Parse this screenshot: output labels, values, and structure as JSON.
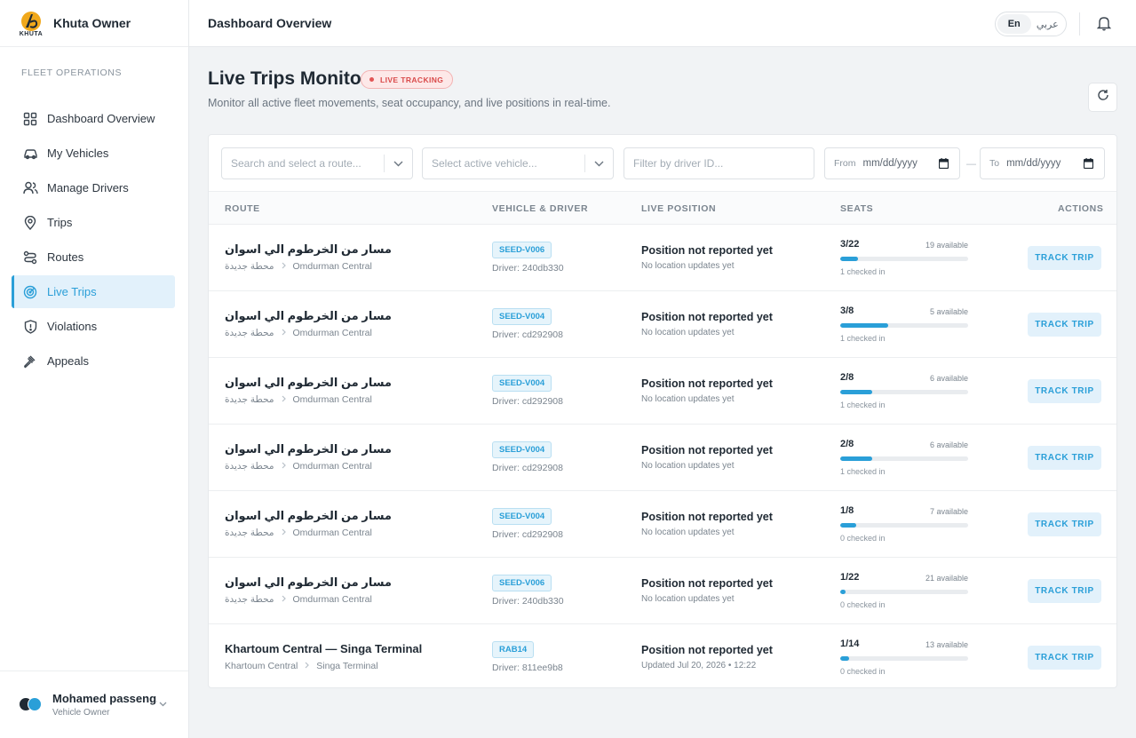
{
  "brand": {
    "name": "Khuta Owner",
    "logo_text": "KHUTA"
  },
  "sidebar": {
    "section_label": "FLEET OPERATIONS",
    "items": [
      {
        "label": "Dashboard Overview",
        "icon": "grid-icon"
      },
      {
        "label": "My Vehicles",
        "icon": "car-icon"
      },
      {
        "label": "Manage Drivers",
        "icon": "users-icon"
      },
      {
        "label": "Trips",
        "icon": "map-pin-icon"
      },
      {
        "label": "Routes",
        "icon": "route-icon"
      },
      {
        "label": "Live Trips",
        "icon": "radar-icon",
        "active": true
      },
      {
        "label": "Violations",
        "icon": "shield-alert-icon"
      },
      {
        "label": "Appeals",
        "icon": "gavel-icon"
      }
    ],
    "user": {
      "name": "Mohamed passeng...",
      "role": "Vehicle Owner"
    }
  },
  "header": {
    "title": "Dashboard Overview",
    "lang_en": "En",
    "lang_ar": "عربي"
  },
  "page": {
    "title": "Live Trips Monitor",
    "badge": "LIVE TRACKING",
    "subtitle": "Monitor all active fleet movements, seat occupancy, and live positions in real-time."
  },
  "filters": {
    "route_placeholder": "Search and select a route...",
    "vehicle_placeholder": "Select active vehicle...",
    "driver_placeholder": "Filter by driver ID...",
    "from_label": "From",
    "to_label": "To",
    "date_placeholder": "mm/dd/yyyy",
    "separator": "—"
  },
  "table": {
    "headers": {
      "route": "ROUTE",
      "vehicle": "VEHICLE & DRIVER",
      "position": "LIVE POSITION",
      "seats": "SEATS",
      "actions": "ACTIONS"
    },
    "action_label": "TRACK TRIP",
    "rows": [
      {
        "route": "مسار من الخرطوم الي اسوان",
        "from": "محطة جديدة",
        "to": "Omdurman Central",
        "vehicle": "SEED-V006",
        "driver": "Driver: 240db330",
        "position": "Position not reported yet",
        "position_sub": "No location updates yet",
        "seats": "3/22",
        "available": "19 available",
        "checked": "1 checked in",
        "fill": 0.136
      },
      {
        "route": "مسار من الخرطوم الي اسوان",
        "from": "محطة جديدة",
        "to": "Omdurman Central",
        "vehicle": "SEED-V004",
        "driver": "Driver: cd292908",
        "position": "Position not reported yet",
        "position_sub": "No location updates yet",
        "seats": "3/8",
        "available": "5 available",
        "checked": "1 checked in",
        "fill": 0.375
      },
      {
        "route": "مسار من الخرطوم الي اسوان",
        "from": "محطة جديدة",
        "to": "Omdurman Central",
        "vehicle": "SEED-V004",
        "driver": "Driver: cd292908",
        "position": "Position not reported yet",
        "position_sub": "No location updates yet",
        "seats": "2/8",
        "available": "6 available",
        "checked": "1 checked in",
        "fill": 0.25
      },
      {
        "route": "مسار من الخرطوم الي اسوان",
        "from": "محطة جديدة",
        "to": "Omdurman Central",
        "vehicle": "SEED-V004",
        "driver": "Driver: cd292908",
        "position": "Position not reported yet",
        "position_sub": "No location updates yet",
        "seats": "2/8",
        "available": "6 available",
        "checked": "1 checked in",
        "fill": 0.25
      },
      {
        "route": "مسار من الخرطوم الي اسوان",
        "from": "محطة جديدة",
        "to": "Omdurman Central",
        "vehicle": "SEED-V004",
        "driver": "Driver: cd292908",
        "position": "Position not reported yet",
        "position_sub": "No location updates yet",
        "seats": "1/8",
        "available": "7 available",
        "checked": "0 checked in",
        "fill": 0.125
      },
      {
        "route": "مسار من الخرطوم الي اسوان",
        "from": "محطة جديدة",
        "to": "Omdurman Central",
        "vehicle": "SEED-V006",
        "driver": "Driver: 240db330",
        "position": "Position not reported yet",
        "position_sub": "No location updates yet",
        "seats": "1/22",
        "available": "21 available",
        "checked": "0 checked in",
        "fill": 0.045
      },
      {
        "route": "Khartoum Central — Singa Terminal",
        "from": "Khartoum Central",
        "to": "Singa Terminal",
        "vehicle": "RAB14",
        "driver": "Driver: 811ee9b8",
        "position": "Position not reported yet",
        "position_sub": "Updated Jul 20, 2026 • 12:22",
        "seats": "1/14",
        "available": "13 available",
        "checked": "0 checked in",
        "fill": 0.071
      }
    ]
  },
  "colors": {
    "accent": "#2a9fd8",
    "live": "#d94a4a"
  }
}
